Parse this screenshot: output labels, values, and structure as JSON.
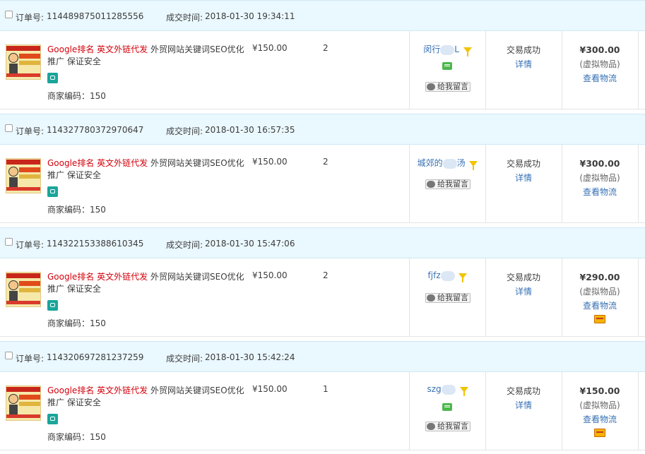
{
  "labels": {
    "order_no": "订单号:",
    "deal_time": "成交时间:",
    "merchant_code_prefix": "商家编码：",
    "leave_message": "给我留言",
    "detail": "详情",
    "virtual_goods": "(虚拟物品)",
    "view_logistics": "查看物流"
  },
  "product": {
    "title_red_1": "Google排名",
    "title_red_2": "英文外链代发",
    "title_rest": "外贸网站关键词SEO优化推广 保证安全",
    "merchant_code": "150",
    "thumbnail_icon": "product-thumbnail"
  },
  "colors": {
    "header_bg": "#eaf8ff",
    "link": "#3670b4",
    "red": "#d4000b",
    "filter_icon": "#f2c400",
    "chat_icon": "#4cb84c",
    "badge": "#1aa59a"
  },
  "orders": [
    {
      "order_id": "114489875011285556",
      "time": "2018-01-30 19:34:11",
      "price": "¥150.00",
      "qty": "2",
      "buyer_visible": "闵行",
      "buyer_tail": "L",
      "status": "交易成功",
      "total": "¥300.00",
      "has_chat_icon": true,
      "has_card_icon": false
    },
    {
      "order_id": "114327780372970647",
      "time": "2018-01-30 16:57:35",
      "price": "¥150.00",
      "qty": "2",
      "buyer_visible": "城郊的",
      "buyer_tail": "汤",
      "status": "交易成功",
      "total": "¥300.00",
      "has_chat_icon": false,
      "has_card_icon": false
    },
    {
      "order_id": "114322153388610345",
      "time": "2018-01-30 15:47:06",
      "price": "¥150.00",
      "qty": "2",
      "buyer_visible": "fjfz",
      "buyer_tail": "",
      "status": "交易成功",
      "total": "¥290.00",
      "has_chat_icon": false,
      "has_card_icon": true
    },
    {
      "order_id": "114320697281237259",
      "time": "2018-01-30 15:42:24",
      "price": "¥150.00",
      "qty": "1",
      "buyer_visible": "szg",
      "buyer_tail": "",
      "status": "交易成功",
      "total": "¥150.00",
      "has_chat_icon": true,
      "has_card_icon": true
    }
  ]
}
